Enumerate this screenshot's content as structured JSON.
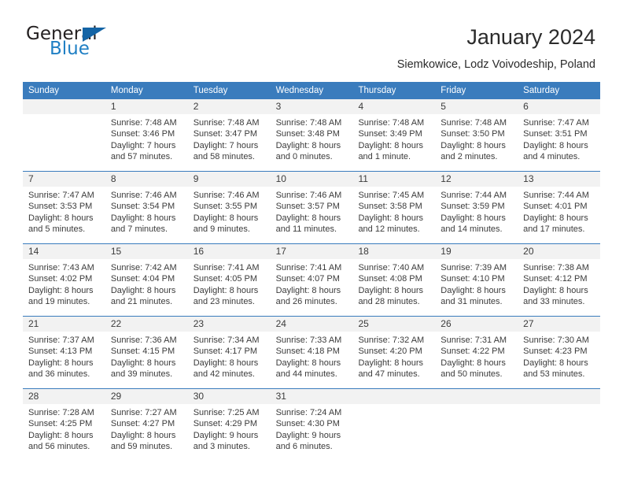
{
  "brand": {
    "name_part1": "General",
    "name_part2": "Blue",
    "triangle_icon": "triangle-icon",
    "colors": {
      "dark": "#231f20",
      "blue": "#1f7fc4",
      "triangle": "#1464a5"
    }
  },
  "header": {
    "title": "January 2024",
    "subtitle": "Siemkowice, Lodz Voivodeship, Poland"
  },
  "theme": {
    "header_bar": "#3a7cbd",
    "day_number_band": "#f2f2f2",
    "row_divider": "#3a7cbd",
    "text": "#3b3b3b"
  },
  "weekdays": [
    "Sunday",
    "Monday",
    "Tuesday",
    "Wednesday",
    "Thursday",
    "Friday",
    "Saturday"
  ],
  "weeks": [
    [
      {
        "day": "",
        "lines": []
      },
      {
        "day": "1",
        "lines": [
          "Sunrise: 7:48 AM",
          "Sunset: 3:46 PM",
          "Daylight: 7 hours",
          "and 57 minutes."
        ]
      },
      {
        "day": "2",
        "lines": [
          "Sunrise: 7:48 AM",
          "Sunset: 3:47 PM",
          "Daylight: 7 hours",
          "and 58 minutes."
        ]
      },
      {
        "day": "3",
        "lines": [
          "Sunrise: 7:48 AM",
          "Sunset: 3:48 PM",
          "Daylight: 8 hours",
          "and 0 minutes."
        ]
      },
      {
        "day": "4",
        "lines": [
          "Sunrise: 7:48 AM",
          "Sunset: 3:49 PM",
          "Daylight: 8 hours",
          "and 1 minute."
        ]
      },
      {
        "day": "5",
        "lines": [
          "Sunrise: 7:48 AM",
          "Sunset: 3:50 PM",
          "Daylight: 8 hours",
          "and 2 minutes."
        ]
      },
      {
        "day": "6",
        "lines": [
          "Sunrise: 7:47 AM",
          "Sunset: 3:51 PM",
          "Daylight: 8 hours",
          "and 4 minutes."
        ]
      }
    ],
    [
      {
        "day": "7",
        "lines": [
          "Sunrise: 7:47 AM",
          "Sunset: 3:53 PM",
          "Daylight: 8 hours",
          "and 5 minutes."
        ]
      },
      {
        "day": "8",
        "lines": [
          "Sunrise: 7:46 AM",
          "Sunset: 3:54 PM",
          "Daylight: 8 hours",
          "and 7 minutes."
        ]
      },
      {
        "day": "9",
        "lines": [
          "Sunrise: 7:46 AM",
          "Sunset: 3:55 PM",
          "Daylight: 8 hours",
          "and 9 minutes."
        ]
      },
      {
        "day": "10",
        "lines": [
          "Sunrise: 7:46 AM",
          "Sunset: 3:57 PM",
          "Daylight: 8 hours",
          "and 11 minutes."
        ]
      },
      {
        "day": "11",
        "lines": [
          "Sunrise: 7:45 AM",
          "Sunset: 3:58 PM",
          "Daylight: 8 hours",
          "and 12 minutes."
        ]
      },
      {
        "day": "12",
        "lines": [
          "Sunrise: 7:44 AM",
          "Sunset: 3:59 PM",
          "Daylight: 8 hours",
          "and 14 minutes."
        ]
      },
      {
        "day": "13",
        "lines": [
          "Sunrise: 7:44 AM",
          "Sunset: 4:01 PM",
          "Daylight: 8 hours",
          "and 17 minutes."
        ]
      }
    ],
    [
      {
        "day": "14",
        "lines": [
          "Sunrise: 7:43 AM",
          "Sunset: 4:02 PM",
          "Daylight: 8 hours",
          "and 19 minutes."
        ]
      },
      {
        "day": "15",
        "lines": [
          "Sunrise: 7:42 AM",
          "Sunset: 4:04 PM",
          "Daylight: 8 hours",
          "and 21 minutes."
        ]
      },
      {
        "day": "16",
        "lines": [
          "Sunrise: 7:41 AM",
          "Sunset: 4:05 PM",
          "Daylight: 8 hours",
          "and 23 minutes."
        ]
      },
      {
        "day": "17",
        "lines": [
          "Sunrise: 7:41 AM",
          "Sunset: 4:07 PM",
          "Daylight: 8 hours",
          "and 26 minutes."
        ]
      },
      {
        "day": "18",
        "lines": [
          "Sunrise: 7:40 AM",
          "Sunset: 4:08 PM",
          "Daylight: 8 hours",
          "and 28 minutes."
        ]
      },
      {
        "day": "19",
        "lines": [
          "Sunrise: 7:39 AM",
          "Sunset: 4:10 PM",
          "Daylight: 8 hours",
          "and 31 minutes."
        ]
      },
      {
        "day": "20",
        "lines": [
          "Sunrise: 7:38 AM",
          "Sunset: 4:12 PM",
          "Daylight: 8 hours",
          "and 33 minutes."
        ]
      }
    ],
    [
      {
        "day": "21",
        "lines": [
          "Sunrise: 7:37 AM",
          "Sunset: 4:13 PM",
          "Daylight: 8 hours",
          "and 36 minutes."
        ]
      },
      {
        "day": "22",
        "lines": [
          "Sunrise: 7:36 AM",
          "Sunset: 4:15 PM",
          "Daylight: 8 hours",
          "and 39 minutes."
        ]
      },
      {
        "day": "23",
        "lines": [
          "Sunrise: 7:34 AM",
          "Sunset: 4:17 PM",
          "Daylight: 8 hours",
          "and 42 minutes."
        ]
      },
      {
        "day": "24",
        "lines": [
          "Sunrise: 7:33 AM",
          "Sunset: 4:18 PM",
          "Daylight: 8 hours",
          "and 44 minutes."
        ]
      },
      {
        "day": "25",
        "lines": [
          "Sunrise: 7:32 AM",
          "Sunset: 4:20 PM",
          "Daylight: 8 hours",
          "and 47 minutes."
        ]
      },
      {
        "day": "26",
        "lines": [
          "Sunrise: 7:31 AM",
          "Sunset: 4:22 PM",
          "Daylight: 8 hours",
          "and 50 minutes."
        ]
      },
      {
        "day": "27",
        "lines": [
          "Sunrise: 7:30 AM",
          "Sunset: 4:23 PM",
          "Daylight: 8 hours",
          "and 53 minutes."
        ]
      }
    ],
    [
      {
        "day": "28",
        "lines": [
          "Sunrise: 7:28 AM",
          "Sunset: 4:25 PM",
          "Daylight: 8 hours",
          "and 56 minutes."
        ]
      },
      {
        "day": "29",
        "lines": [
          "Sunrise: 7:27 AM",
          "Sunset: 4:27 PM",
          "Daylight: 8 hours",
          "and 59 minutes."
        ]
      },
      {
        "day": "30",
        "lines": [
          "Sunrise: 7:25 AM",
          "Sunset: 4:29 PM",
          "Daylight: 9 hours",
          "and 3 minutes."
        ]
      },
      {
        "day": "31",
        "lines": [
          "Sunrise: 7:24 AM",
          "Sunset: 4:30 PM",
          "Daylight: 9 hours",
          "and 6 minutes."
        ]
      },
      {
        "day": "",
        "lines": []
      },
      {
        "day": "",
        "lines": []
      },
      {
        "day": "",
        "lines": []
      }
    ]
  ]
}
